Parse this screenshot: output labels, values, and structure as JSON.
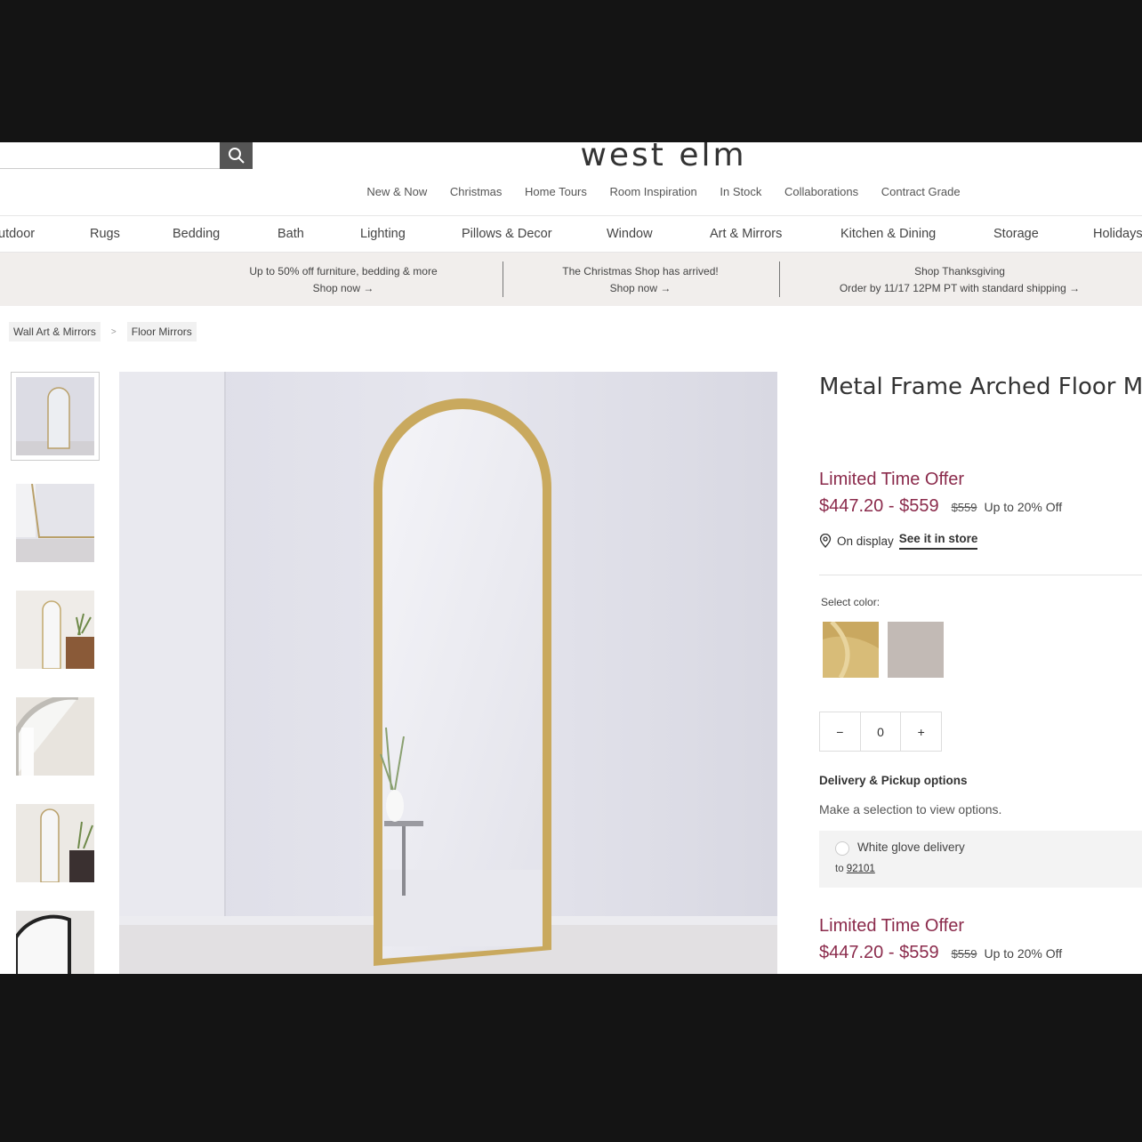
{
  "header": {
    "brand": "west elm",
    "top_links": [
      "New & Now",
      "Christmas",
      "Home Tours",
      "Room Inspiration",
      "In Stock",
      "Collaborations",
      "Contract Grade"
    ]
  },
  "categories": [
    "utdoor",
    "Rugs",
    "Bedding",
    "Bath",
    "Lighting",
    "Pillows & Decor",
    "Window",
    "Art & Mirrors",
    "Kitchen & Dining",
    "Storage",
    "Holidays"
  ],
  "promos": [
    {
      "line1": "Up to 50% off furniture, bedding & more",
      "line2": "Shop now →"
    },
    {
      "line1": "The Christmas Shop has arrived!",
      "line2": "Shop now →"
    },
    {
      "line1": "Shop Thanksgiving",
      "line2": "Order by 11/17 12PM PT with standard shipping →"
    }
  ],
  "breadcrumb": [
    "Wall Art & Mirrors",
    "Floor Mirrors"
  ],
  "breadcrumb_sep": ">",
  "product": {
    "title": "Metal Frame Arched Floor M",
    "offer_label": "Limited Time Offer",
    "price_range": "$447.20 - $559",
    "was_price": "$559",
    "discount": "Up to 20% Off",
    "on_display": "On display",
    "see_in_store": "See it in store",
    "select_color_label": "Select color:",
    "colors": [
      "#c9a860",
      "#c2bab5"
    ],
    "quantity": "0",
    "minus": "−",
    "plus": "+",
    "delivery_title": "Delivery & Pickup options",
    "delivery_sub": "Make a selection to view options.",
    "white_glove": "White glove delivery",
    "zip_prefix": "to",
    "zip": "92101"
  }
}
